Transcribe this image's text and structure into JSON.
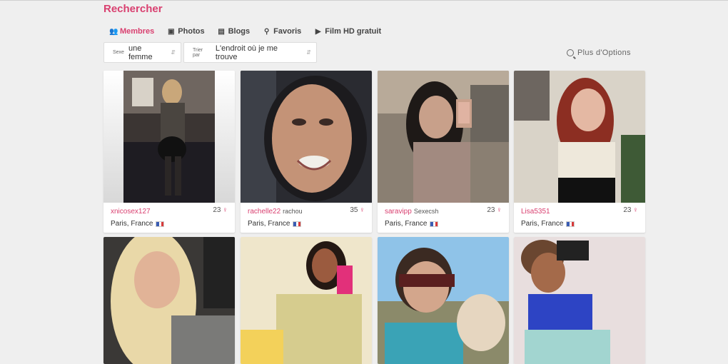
{
  "page": {
    "title": "Rechercher"
  },
  "tabs": [
    {
      "label": "Membres",
      "icon": "users-icon",
      "active": true
    },
    {
      "label": "Photos",
      "icon": "camera-icon",
      "active": false
    },
    {
      "label": "Blogs",
      "icon": "newspaper-icon",
      "active": false
    },
    {
      "label": "Favoris",
      "icon": "pin-icon",
      "active": false
    },
    {
      "label": "Film HD gratuit",
      "icon": "video-icon",
      "active": false
    }
  ],
  "filters": {
    "sexe": {
      "label": "Sexe",
      "value": "une femme"
    },
    "trier": {
      "label": "Trier par",
      "value": "L'endroit où je me trouve"
    }
  },
  "more_options": "Plus d'Options",
  "colors": {
    "accent": "#d94070",
    "background": "#efefef"
  },
  "profiles": [
    {
      "username": "xnicosex127",
      "alias": "",
      "age": "23",
      "location": "Paris, France",
      "gender_symbol": "♀"
    },
    {
      "username": "rachelle22",
      "alias": "rachou",
      "age": "35",
      "location": "Paris, France",
      "gender_symbol": "♀"
    },
    {
      "username": "saravipp",
      "alias": "Sexecsh",
      "age": "23",
      "location": "Paris, France",
      "gender_symbol": "♀"
    },
    {
      "username": "Lisa5351",
      "alias": "",
      "age": "23",
      "location": "Paris, France",
      "gender_symbol": "♀"
    }
  ]
}
